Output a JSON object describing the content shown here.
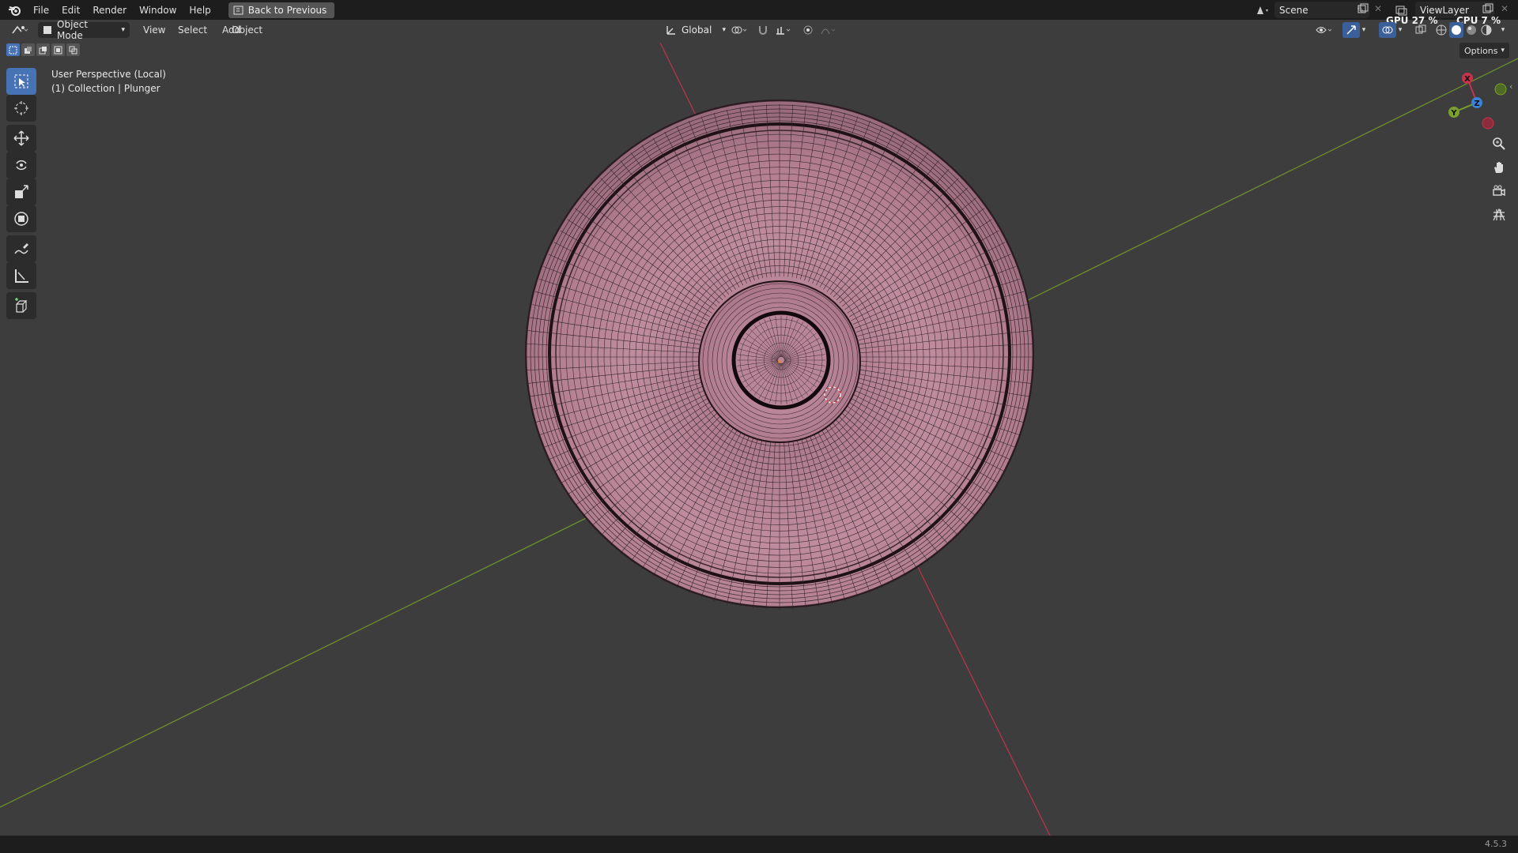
{
  "menu": {
    "items": [
      "File",
      "Edit",
      "Render",
      "Window",
      "Help"
    ],
    "back_label": "Back to Previous"
  },
  "scene": {
    "label": "Scene"
  },
  "view_layer": {
    "label": "ViewLayer"
  },
  "stats": {
    "gpu": "GPU 27 %",
    "cpu": "CPU 7 %"
  },
  "header": {
    "mode": "Object Mode",
    "menus": [
      "View",
      "Select",
      "Add",
      "Object"
    ],
    "transform_orientation": "Global"
  },
  "overlay": {
    "view_name": "User Perspective (Local)",
    "collection": "(1) Collection | Plunger"
  },
  "options": {
    "label": "Options"
  },
  "gizmo": {
    "x": "X",
    "y": "Y",
    "z": "Z"
  },
  "status": {
    "version": "4.5.3"
  },
  "colors": {
    "mesh": "#b9869a",
    "x_axis": "#c6344b",
    "y_axis": "#7aa12e",
    "z_axis": "#3b82dc",
    "selection_accent": "#4772b3"
  },
  "icons": {
    "tools": [
      "select-box-icon",
      "cursor-icon",
      "move-icon",
      "rotate-icon",
      "scale-icon",
      "transform-icon",
      "annotate-icon",
      "measure-icon",
      "add-cube-icon"
    ],
    "nav": [
      "zoom-icon",
      "pan-hand-icon",
      "camera-icon",
      "grid-icon"
    ]
  }
}
